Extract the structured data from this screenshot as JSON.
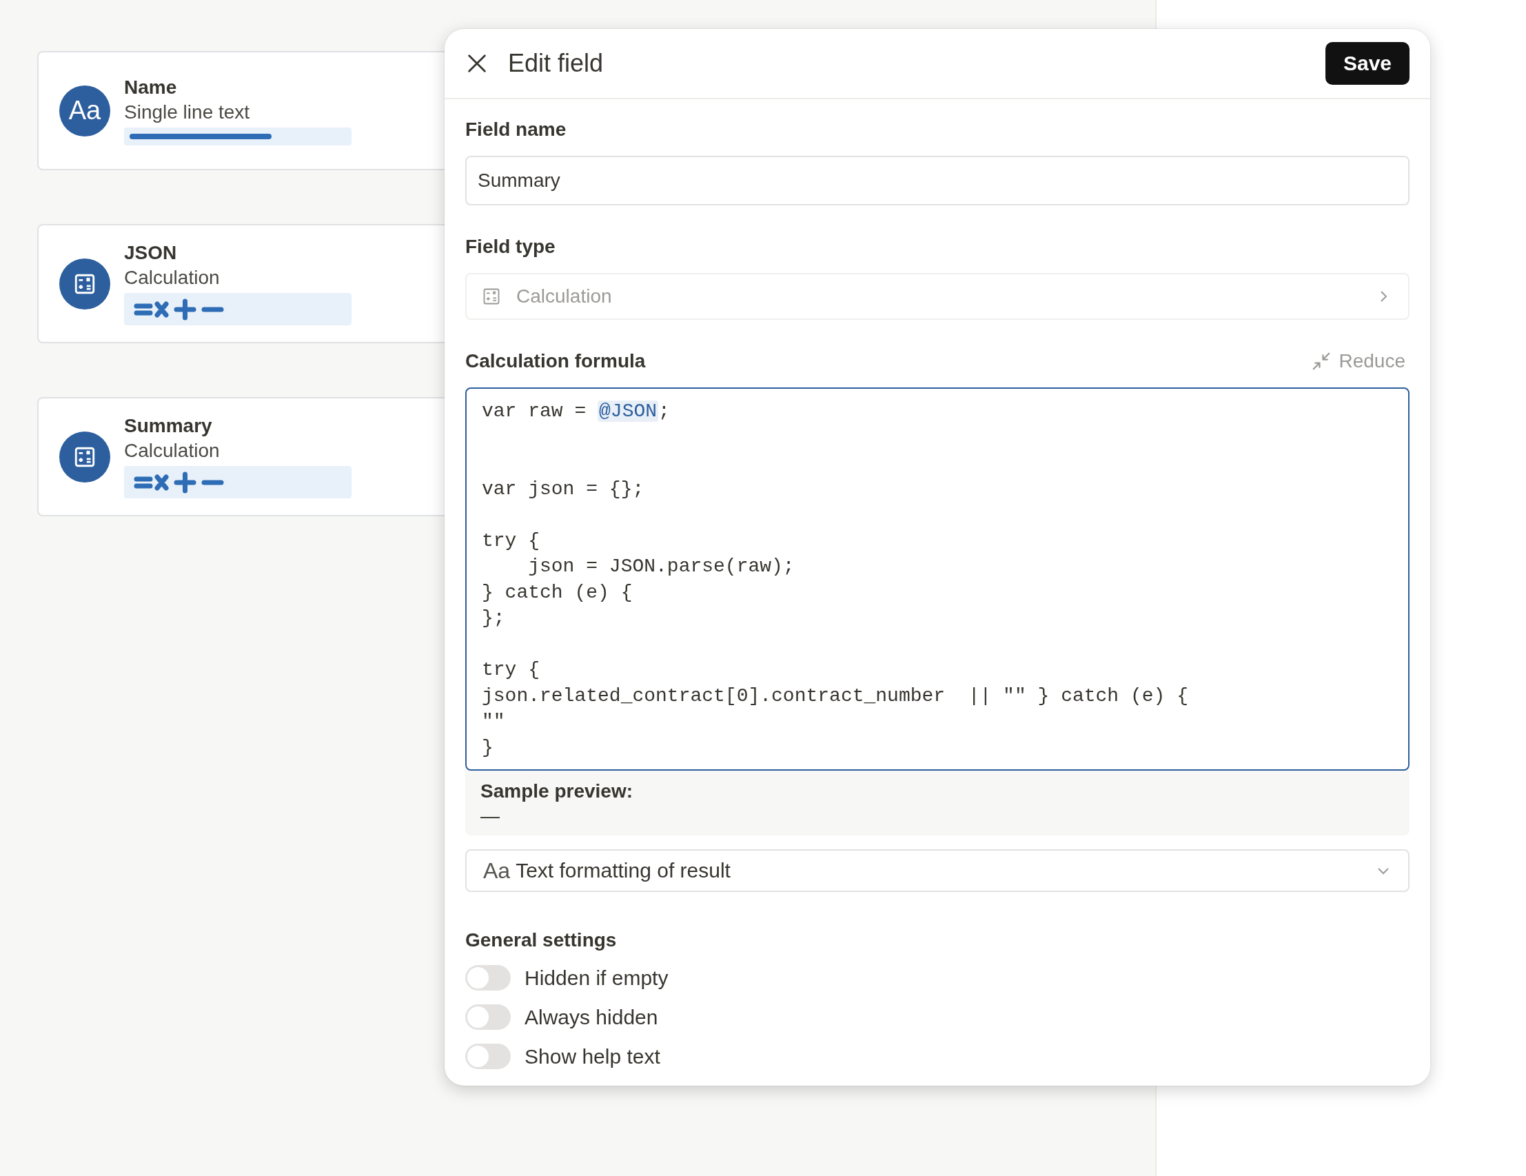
{
  "fields": [
    {
      "kind": "text",
      "badge": "Aa",
      "name": "Name",
      "type": "Single line text"
    },
    {
      "kind": "calculation",
      "name": "JSON",
      "type": "Calculation"
    },
    {
      "kind": "calculation",
      "name": "Summary",
      "type": "Calculation"
    }
  ],
  "panel": {
    "title": "Edit field",
    "save": "Save",
    "field_name": {
      "label": "Field name",
      "value": "Summary"
    },
    "field_type": {
      "label": "Field type",
      "value": "Calculation",
      "disabled": true
    },
    "formula": {
      "label": "Calculation formula",
      "reduce": "Reduce",
      "before": "var raw = ",
      "token": "@JSON",
      "after": ";\n\n\nvar json = {};\n\ntry {\n    json = JSON.parse(raw);\n} catch (e) {\n};\n\ntry {\njson.related_contract[0].contract_number  || \"\" } catch (e) {\n\"\"\n}"
    },
    "preview": {
      "label": "Sample preview:",
      "value": "—"
    },
    "formatting": {
      "badge": "Aa",
      "label": "Text formatting of result"
    },
    "general": {
      "label": "General settings",
      "toggles": [
        {
          "label": "Hidden if empty",
          "on": false
        },
        {
          "label": "Always hidden",
          "on": false
        },
        {
          "label": "Show help text",
          "on": false
        }
      ]
    }
  }
}
